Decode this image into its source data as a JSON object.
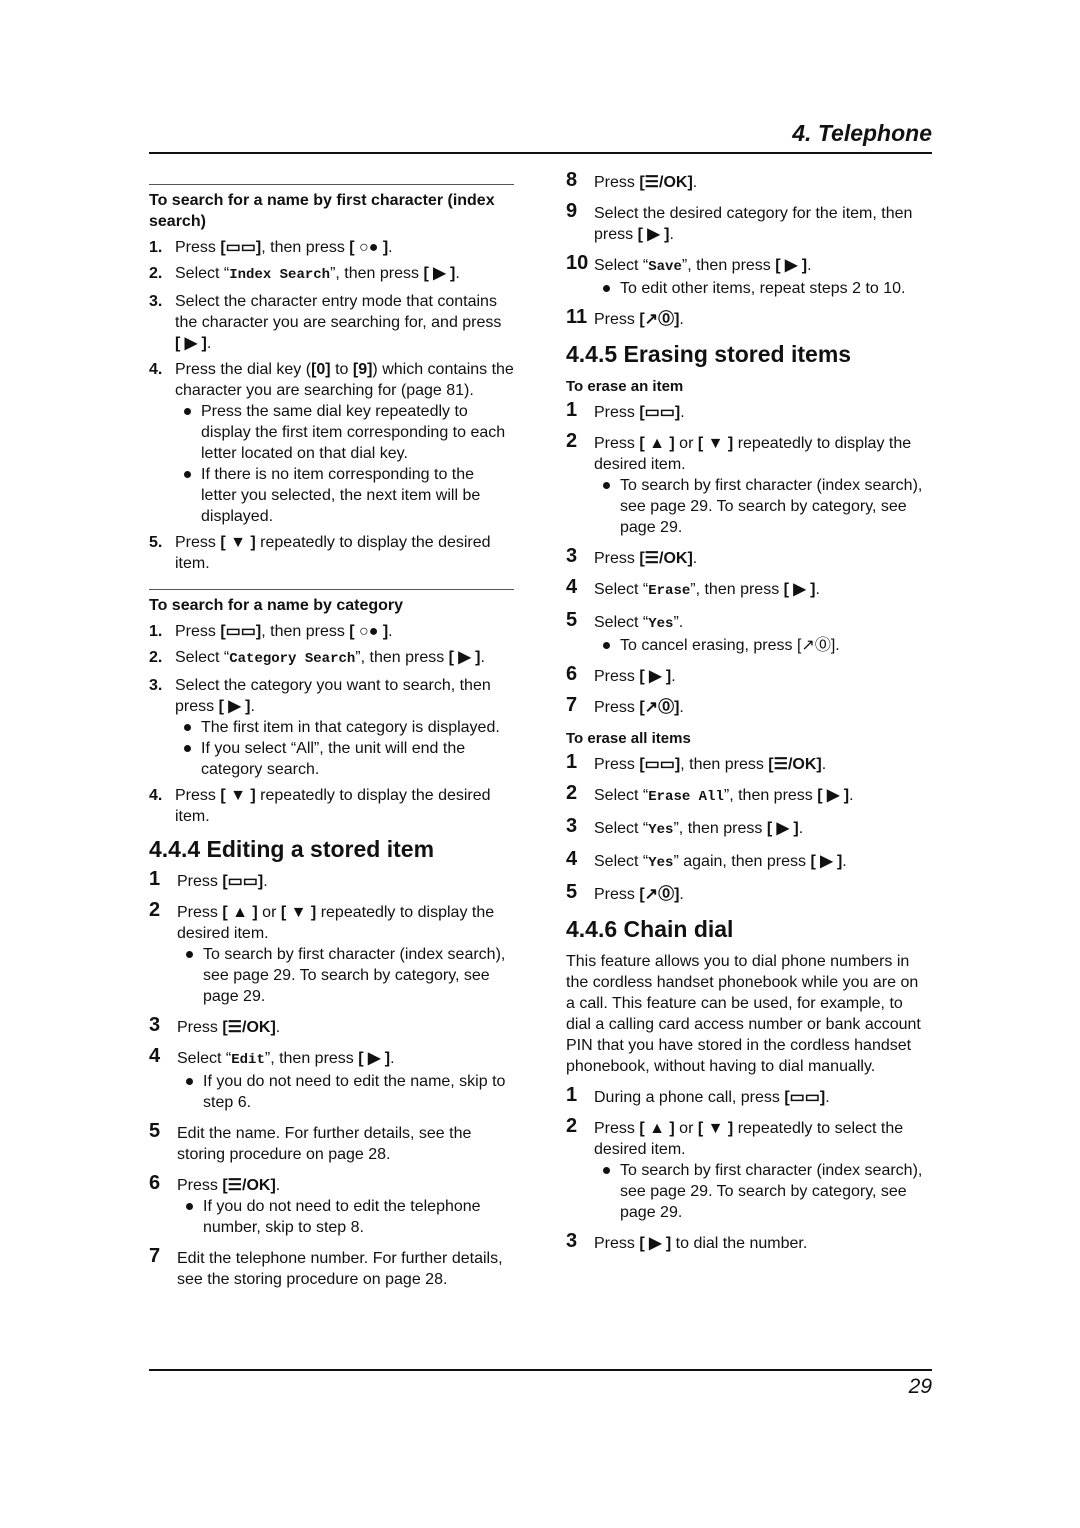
{
  "header": {
    "chapter": "4. Telephone"
  },
  "footer": {
    "page_number": "29"
  },
  "icons": {
    "phonebook": "[▭▭]",
    "ok": "[☰/OK]",
    "right": "[ ▶ ]",
    "down": "[ ▼ ]",
    "up": "[ ▲ ]",
    "off": "[↗⓪]",
    "index": "[ ○● ]",
    "key0": "[0]",
    "key9": "[9]"
  },
  "left": {
    "index_search": {
      "title": "To search for a name by first character (index search)",
      "steps": [
        {
          "num": "1.",
          "parts": [
            "Press ",
            "{phonebook}",
            ", then press ",
            "{index}",
            "."
          ]
        },
        {
          "num": "2.",
          "parts": [
            "Select “",
            "Index Search",
            "”, then press ",
            "{right}",
            "."
          ]
        },
        {
          "num": "3.",
          "parts": [
            "Select the character entry mode that contains the character you are searching for, and press ",
            "{right}",
            "."
          ]
        },
        {
          "num": "4.",
          "parts": [
            "Press the dial key (",
            "{key0}",
            " to ",
            "{key9}",
            ") which contains the character you are searching for (page 81)."
          ],
          "bullets": [
            "Press the same dial key repeatedly to display the first item corresponding to each letter located on that dial key.",
            "If there is no item corresponding to the letter you selected, the next item will be displayed."
          ]
        },
        {
          "num": "5.",
          "parts": [
            "Press ",
            "{down}",
            " repeatedly to display the desired item."
          ]
        }
      ]
    },
    "category_search": {
      "title": "To search for a name by category",
      "steps": [
        {
          "num": "1.",
          "parts": [
            "Press ",
            "{phonebook}",
            ", then press ",
            "{index}",
            "."
          ]
        },
        {
          "num": "2.",
          "parts": [
            "Select “",
            "Category Search",
            "”, then press ",
            "{right}",
            "."
          ]
        },
        {
          "num": "3.",
          "parts": [
            "Select the category you want to search, then press ",
            "{right}",
            "."
          ],
          "bullets": [
            "The first item in that category is displayed.",
            "If you select “All”, the unit will end the category search."
          ]
        },
        {
          "num": "4.",
          "parts": [
            "Press ",
            "{down}",
            " repeatedly to display the desired item."
          ]
        }
      ]
    },
    "editing": {
      "title": "4.4.4 Editing a stored item",
      "steps": [
        {
          "num": "1",
          "parts": [
            "Press ",
            "{phonebook}",
            "."
          ]
        },
        {
          "num": "2",
          "parts": [
            "Press ",
            "{up}",
            " or ",
            "{down}",
            " repeatedly to display the desired item."
          ],
          "bullets": [
            "To search by first character (index search), see page 29. To search by category, see page 29."
          ]
        },
        {
          "num": "3",
          "parts": [
            "Press ",
            "{ok}",
            "."
          ]
        },
        {
          "num": "4",
          "parts": [
            "Select “",
            "Edit",
            "”, then press ",
            "{right}",
            "."
          ],
          "bullets": [
            "If you do not need to edit the name, skip to step 6."
          ]
        },
        {
          "num": "5",
          "parts": [
            "Edit the name. For further details, see the storing procedure on page 28."
          ]
        },
        {
          "num": "6",
          "parts": [
            "Press ",
            "{ok}",
            "."
          ],
          "bullets": [
            "If you do not need to edit the telephone number, skip to step 8."
          ]
        },
        {
          "num": "7",
          "parts": [
            "Edit the telephone number. For further details, see the storing procedure on page 28."
          ]
        }
      ]
    }
  },
  "right": {
    "editing_cont": {
      "steps": [
        {
          "num": "8",
          "parts": [
            "Press ",
            "{ok}",
            "."
          ]
        },
        {
          "num": "9",
          "parts": [
            "Select the desired category for the item, then press ",
            "{right}",
            "."
          ]
        },
        {
          "num": "10",
          "parts": [
            "Select “",
            "Save",
            "”, then press ",
            "{right}",
            "."
          ],
          "bullets": [
            "To edit other items, repeat steps 2 to 10."
          ]
        },
        {
          "num": "11",
          "parts": [
            "Press ",
            "{off}",
            "."
          ]
        }
      ]
    },
    "erasing": {
      "title": "4.4.5 Erasing stored items",
      "erase_one": {
        "title": "To erase an item",
        "steps": [
          {
            "num": "1",
            "parts": [
              "Press ",
              "{phonebook}",
              "."
            ]
          },
          {
            "num": "2",
            "parts": [
              "Press ",
              "{up}",
              " or ",
              "{down}",
              " repeatedly to display the desired item."
            ],
            "bullets": [
              "To search by first character (index search), see page 29. To search by category, see page 29."
            ]
          },
          {
            "num": "3",
            "parts": [
              "Press ",
              "{ok}",
              "."
            ]
          },
          {
            "num": "4",
            "parts": [
              "Select “",
              "Erase",
              "”, then press ",
              "{right}",
              "."
            ]
          },
          {
            "num": "5",
            "parts": [
              "Select “",
              "Yes",
              "”."
            ],
            "bullets": [
              "To cancel erasing, press [↗⓪]."
            ]
          },
          {
            "num": "6",
            "parts": [
              "Press ",
              "{right}",
              "."
            ]
          },
          {
            "num": "7",
            "parts": [
              "Press ",
              "{off}",
              "."
            ]
          }
        ]
      },
      "erase_all": {
        "title": "To erase all items",
        "steps": [
          {
            "num": "1",
            "parts": [
              "Press ",
              "{phonebook}",
              ", then press ",
              "{ok}",
              "."
            ]
          },
          {
            "num": "2",
            "parts": [
              "Select “",
              "Erase All",
              "”, then press ",
              "{right}",
              "."
            ]
          },
          {
            "num": "3",
            "parts": [
              "Select “",
              "Yes",
              "”, then press ",
              "{right}",
              "."
            ]
          },
          {
            "num": "4",
            "parts": [
              "Select “",
              "Yes",
              "” again, then press ",
              "{right}",
              "."
            ]
          },
          {
            "num": "5",
            "parts": [
              "Press ",
              "{off}",
              "."
            ]
          }
        ]
      }
    },
    "chain_dial": {
      "title": "4.4.6 Chain dial",
      "intro": "This feature allows you to dial phone numbers in the cordless handset phonebook while you are on a call. This feature can be used, for example, to dial a calling card access number or bank account PIN that you have stored in the cordless handset phonebook, without having to dial manually.",
      "steps": [
        {
          "num": "1",
          "parts": [
            "During a phone call, press ",
            "{phonebook}",
            "."
          ]
        },
        {
          "num": "2",
          "parts": [
            "Press ",
            "{up}",
            " or ",
            "{down}",
            " repeatedly to select the desired item."
          ],
          "bullets": [
            "To search by first character (index search), see page 29. To search by category, see page 29."
          ]
        },
        {
          "num": "3",
          "parts": [
            "Press ",
            "{right}",
            " to dial the number."
          ]
        }
      ]
    }
  }
}
